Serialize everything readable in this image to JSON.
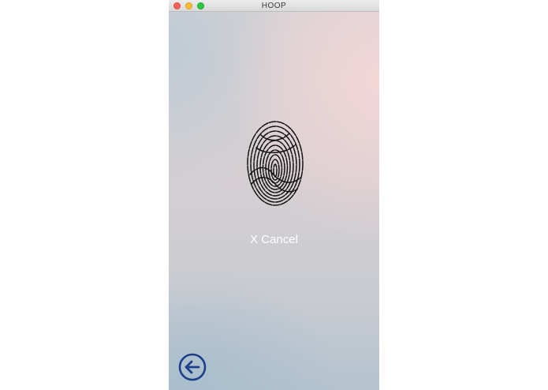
{
  "window": {
    "title": "HOOP"
  },
  "auth": {
    "fingerprint_icon": "fingerprint-icon",
    "cancel_label": "X Cancel"
  },
  "navigation": {
    "back_icon": "arrow-left-circle-icon"
  },
  "colors": {
    "accent": "#1f3e8a",
    "close": "#fc5f57",
    "minimize": "#fdbc2e",
    "maximize": "#28c840"
  }
}
